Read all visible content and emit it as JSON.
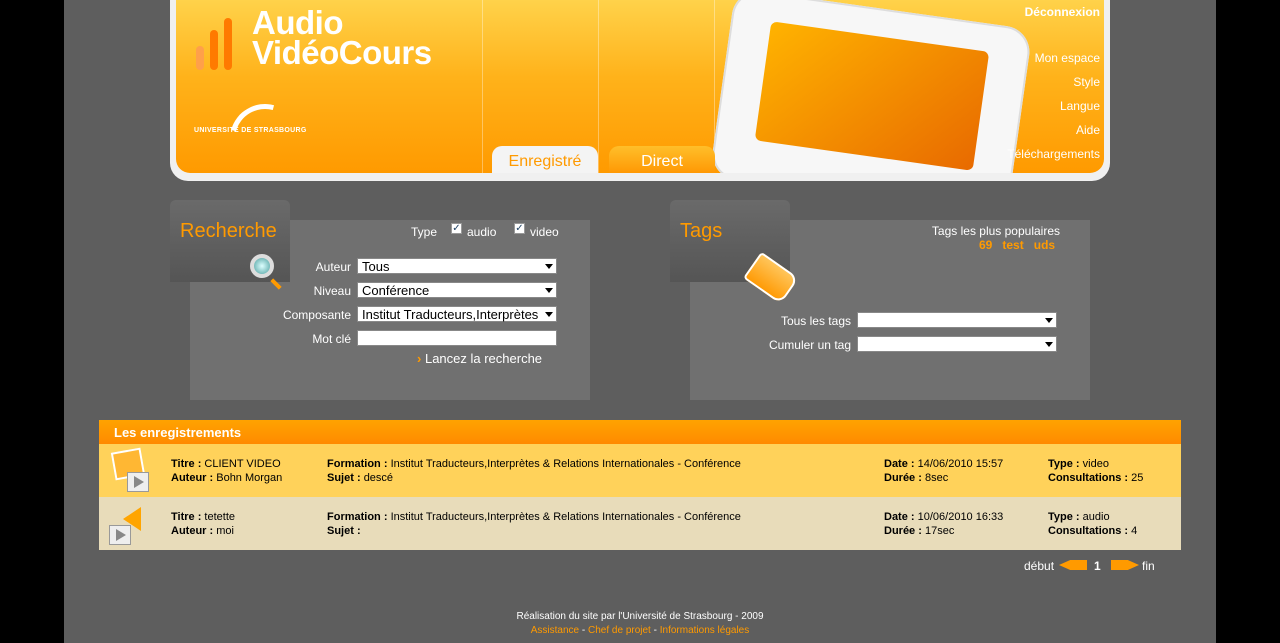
{
  "header": {
    "logo_line1": "Audio",
    "logo_line2": "VidéoCours",
    "university": "UNIVERSITÉ DE STRASBOURG",
    "nav": {
      "logout": "Déconnexion",
      "my_space": "Mon espace",
      "style": "Style",
      "language": "Langue",
      "help": "Aide",
      "downloads": "Téléchargements"
    },
    "tabs": {
      "recorded": "Enregistré",
      "live": "Direct"
    }
  },
  "search": {
    "title": "Recherche",
    "type_label": "Type",
    "audio_label": "audio",
    "video_label": "video",
    "audio_checked": true,
    "video_checked": true,
    "author_label": "Auteur",
    "author_value": "Tous",
    "level_label": "Niveau",
    "level_value": "Conférence",
    "component_label": "Composante",
    "component_value": "Institut Traducteurs,Interprètes",
    "keyword_label": "Mot clé",
    "keyword_value": "",
    "submit": "Lancez la recherche"
  },
  "tags": {
    "title": "Tags",
    "popular_label": "Tags les plus populaires",
    "popular": [
      "69",
      "test",
      "uds"
    ],
    "all_tags_label": "Tous les tags",
    "all_tags_value": "",
    "combine_label": "Cumuler un tag",
    "combine_value": ""
  },
  "recordings": {
    "title": "Les enregistrements",
    "labels": {
      "title": "Titre :",
      "author": "Auteur :",
      "formation": "Formation :",
      "subject": "Sujet :",
      "date": "Date :",
      "duration": "Durée :",
      "type": "Type :",
      "views": "Consultations :"
    },
    "rows": [
      {
        "title": "CLIENT VIDEO",
        "author": "Bohn Morgan",
        "formation": "Institut Traducteurs,Interprètes & Relations Internationales - Conférence",
        "subject": "descé",
        "date": "14/06/2010 15:57",
        "duration": "8sec",
        "type": "video",
        "views": "25",
        "icon": "video-icon"
      },
      {
        "title": "tetette",
        "author": "moi",
        "formation": "Institut Traducteurs,Interprètes & Relations Internationales - Conférence",
        "subject": "",
        "date": "10/06/2010 16:33",
        "duration": "17sec",
        "type": "audio",
        "views": "4",
        "icon": "audio-icon"
      }
    ]
  },
  "pagination": {
    "first": "début",
    "page": "1",
    "last": "fin"
  },
  "footer": {
    "credit": "Réalisation du site par l'Université de Strasbourg - 2009",
    "assistance": "Assistance",
    "project_lead": "Chef de projet",
    "legal": "Informations légales",
    "sep": "-"
  },
  "colors": {
    "accent": "#ff9a00",
    "background": "#5e5e5e",
    "row1": "#ffd25a",
    "row2": "#e8dcba"
  }
}
